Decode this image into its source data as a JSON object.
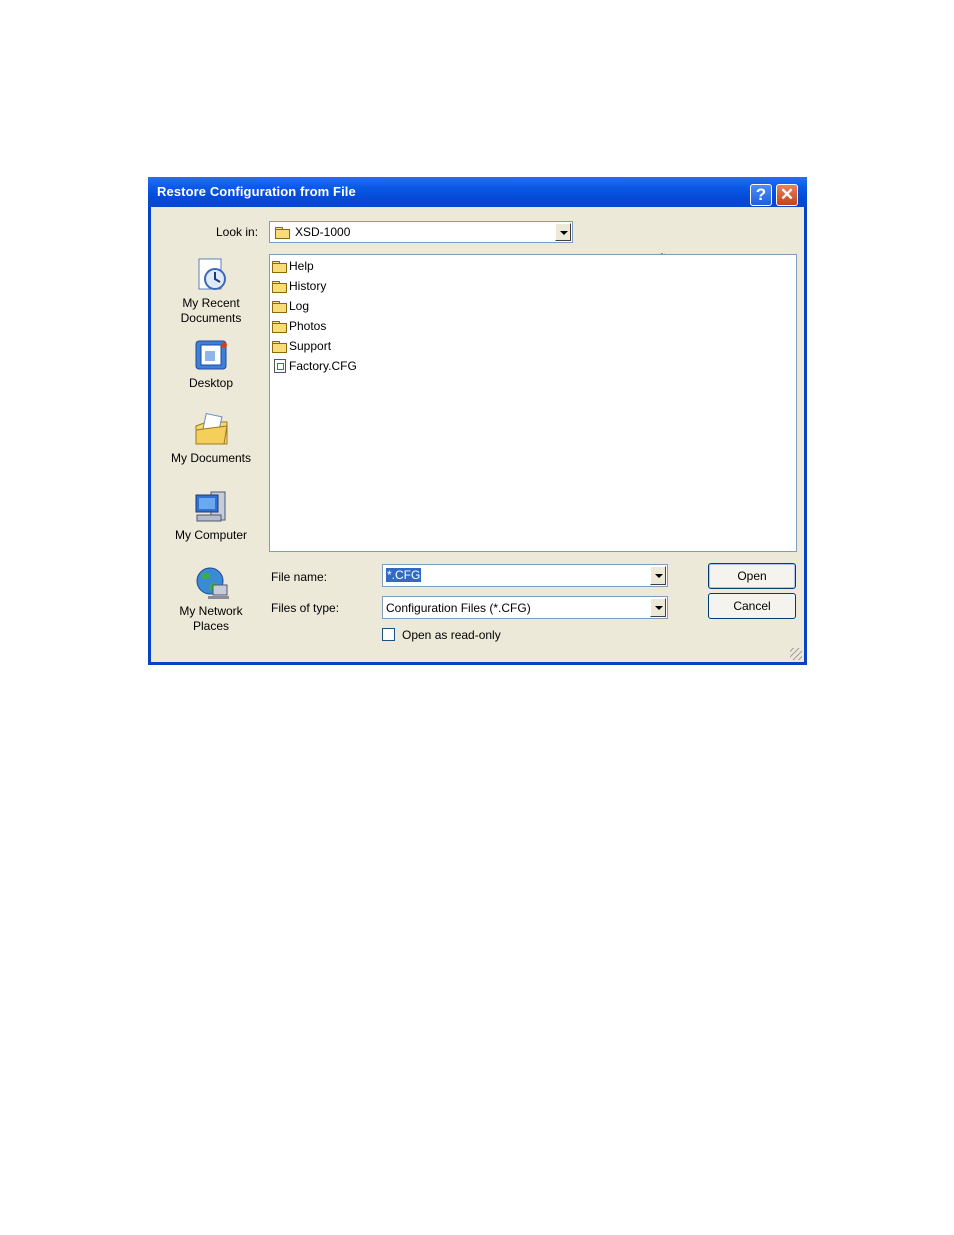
{
  "window": {
    "title": "Restore Configuration from File",
    "help_label": "?",
    "close_label": "✕"
  },
  "look_in": {
    "label": "Look in:",
    "value": "XSD-1000"
  },
  "places": [
    {
      "label": "My Recent Documents"
    },
    {
      "label": "Desktop"
    },
    {
      "label": "My Documents"
    },
    {
      "label": "My Computer"
    },
    {
      "label": "My Network Places"
    }
  ],
  "files": [
    {
      "name": "Help",
      "icon": "folder-icon"
    },
    {
      "name": "History",
      "icon": "folder-icon"
    },
    {
      "name": "Log",
      "icon": "folder-icon"
    },
    {
      "name": "Photos",
      "icon": "folder-icon"
    },
    {
      "name": "Support",
      "icon": "folder-icon"
    },
    {
      "name": "Factory.CFG",
      "icon": "config-file-icon"
    }
  ],
  "file_name": {
    "label": "File name:",
    "value": "*.CFG"
  },
  "file_type": {
    "label": "Files of type:",
    "value": "Configuration Files (*.CFG)"
  },
  "read_only": {
    "label": "Open as read-only",
    "checked": false
  },
  "buttons": {
    "open": "Open",
    "cancel": "Cancel"
  }
}
